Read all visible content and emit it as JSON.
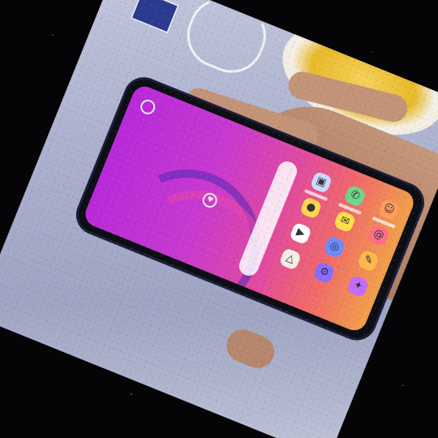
{
  "image": {
    "kind": "photo",
    "subject": "hand holding a smartphone on a table",
    "frame": "rotated photo on a starfield background"
  },
  "phone": {
    "home_screen_icons": [
      "gallery-icon",
      "camera-icon",
      "play-store-icon",
      "google-drive-icon",
      "phone-icon",
      "messages-icon",
      "browser-icon",
      "settings-icon",
      "contacts-icon",
      "email-icon",
      "notes-icon",
      "bixby-icon"
    ],
    "center_widget_icon": "heart-cloud-icon"
  },
  "colors": {
    "background": "#050508",
    "table": "#aab0cd",
    "screen_left": "#b82ad9",
    "screen_right": "#f2a04a",
    "phone_body": "#0d0d14",
    "skin": "#b68569"
  }
}
